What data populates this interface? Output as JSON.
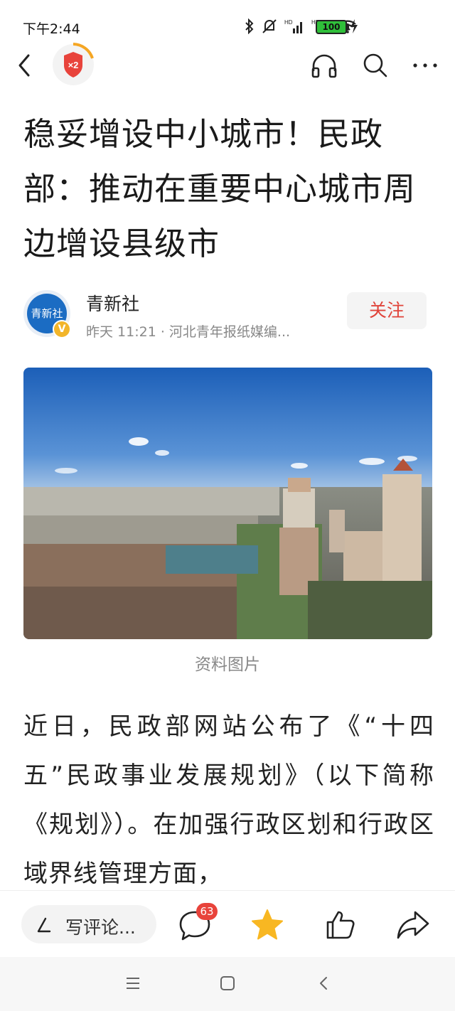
{
  "status_bar": {
    "time": "下午2:44",
    "battery": "100",
    "icons": [
      "bluetooth-icon",
      "mute-icon",
      "hd-signal-icon",
      "hd-signal-icon",
      "wifi-icon",
      "battery-icon",
      "charging-icon"
    ]
  },
  "top_nav": {
    "back_icon": "chevron-left-icon",
    "reward_badge": "×2",
    "actions": [
      "headphones-icon",
      "search-icon",
      "more-icon"
    ]
  },
  "article": {
    "title": "稳妥增设中小城市！民政部：推动在重要中心城市周边增设县级市",
    "author": {
      "avatar_text": "青新社",
      "verified": "V",
      "name": "青新社",
      "meta": "昨天 11:21 · 河北青年报纸媒编..."
    },
    "follow_label": "关注",
    "photo_caption": "资料图片",
    "body": "近日，民政部网站公布了《“十四五”民政事业发展规划》（以下简称《规划》）。在加强行政区划和行政区域界线管理方面，"
  },
  "bottom_toolbar": {
    "comment_placeholder": "写评论...",
    "comment_count": "63",
    "favorited": true,
    "colors": {
      "star": "#f8b722",
      "badge": "#e8433b",
      "follow": "#e0443a"
    }
  },
  "system_nav": [
    "menu-icon",
    "home-icon",
    "back-icon"
  ]
}
